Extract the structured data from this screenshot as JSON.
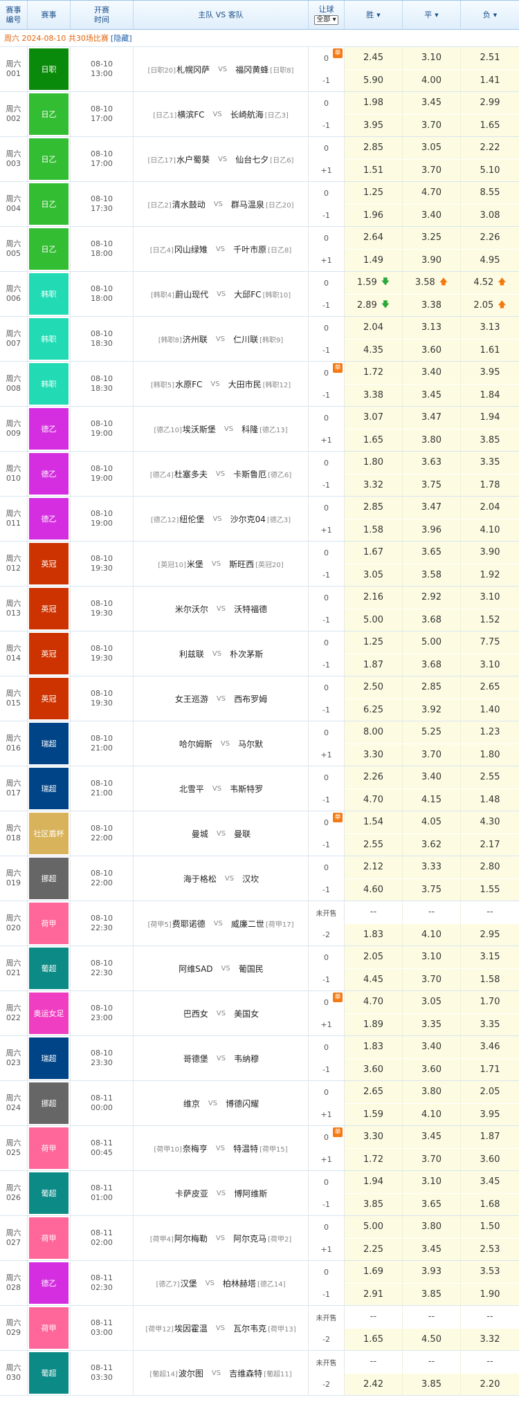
{
  "header": {
    "id_l1": "赛事",
    "id_l2": "编号",
    "league": "赛事",
    "time_l1": "开赛",
    "time_l2": "时间",
    "teams": "主队 VS 客队",
    "handicap": "让球",
    "handicap_select": "全部",
    "win": "胜",
    "draw": "平",
    "lose": "负"
  },
  "day": {
    "text": "周六 2024-08-10 共30场比赛",
    "hide_link": "[隐藏]"
  },
  "colors": {
    "日职": "#0a8a0a",
    "日乙": "#33bd33",
    "韩职": "#22dbb4",
    "德乙": "#d42ee0",
    "英冠": "#cc3300",
    "瑞超": "#004488",
    "社区盾杯": "#d9b35b",
    "挪超": "#666666",
    "荷甲": "#ff6699",
    "葡超": "#0b8a86",
    "奥运女足": "#f03ec2"
  },
  "dan_label": "单",
  "matches": [
    {
      "day": "周六",
      "num": "001",
      "league": "日职",
      "date": "08-10",
      "time": "13:00",
      "home_rank": "[日职20]",
      "home": "札幌冈萨",
      "away": "福冈黄蜂",
      "away_rank": "[日职8]",
      "dan": true,
      "hc": [
        "0",
        "-1"
      ],
      "odds": [
        [
          "2.45",
          "3.10",
          "2.51"
        ],
        [
          "5.90",
          "4.00",
          "1.41"
        ]
      ]
    },
    {
      "day": "周六",
      "num": "002",
      "league": "日乙",
      "date": "08-10",
      "time": "17:00",
      "home_rank": "[日乙1]",
      "home": "横滨FC",
      "away": "长崎航海",
      "away_rank": "[日乙3]",
      "hc": [
        "0",
        "-1"
      ],
      "odds": [
        [
          "1.98",
          "3.45",
          "2.99"
        ],
        [
          "3.95",
          "3.70",
          "1.65"
        ]
      ]
    },
    {
      "day": "周六",
      "num": "003",
      "league": "日乙",
      "date": "08-10",
      "time": "17:00",
      "home_rank": "[日乙17]",
      "home": "水户蜀葵",
      "away": "仙台七夕",
      "away_rank": "[日乙6]",
      "hc": [
        "0",
        "+1"
      ],
      "odds": [
        [
          "2.85",
          "3.05",
          "2.22"
        ],
        [
          "1.51",
          "3.70",
          "5.10"
        ]
      ]
    },
    {
      "day": "周六",
      "num": "004",
      "league": "日乙",
      "date": "08-10",
      "time": "17:30",
      "home_rank": "[日乙2]",
      "home": "清水鼓动",
      "away": "群马温泉",
      "away_rank": "[日乙20]",
      "hc": [
        "0",
        "-1"
      ],
      "odds": [
        [
          "1.25",
          "4.70",
          "8.55"
        ],
        [
          "1.96",
          "3.40",
          "3.08"
        ]
      ]
    },
    {
      "day": "周六",
      "num": "005",
      "league": "日乙",
      "date": "08-10",
      "time": "18:00",
      "home_rank": "[日乙4]",
      "home": "冈山绿雉",
      "away": "千叶市原",
      "away_rank": "[日乙8]",
      "hc": [
        "0",
        "+1"
      ],
      "odds": [
        [
          "2.64",
          "3.25",
          "2.26"
        ],
        [
          "1.49",
          "3.90",
          "4.95"
        ]
      ]
    },
    {
      "day": "周六",
      "num": "006",
      "league": "韩职",
      "date": "08-10",
      "time": "18:00",
      "home_rank": "[韩职4]",
      "home": "蔚山现代",
      "away": "大邱FC",
      "away_rank": "[韩职10]",
      "hc": [
        "0",
        "-1"
      ],
      "odds": [
        [
          "1.59",
          "3.58",
          "4.52"
        ],
        [
          "2.89",
          "3.38",
          "2.05"
        ]
      ],
      "arrows": [
        [
          "down",
          "up",
          "up"
        ],
        [
          "down",
          "",
          "up"
        ]
      ]
    },
    {
      "day": "周六",
      "num": "007",
      "league": "韩职",
      "date": "08-10",
      "time": "18:30",
      "home_rank": "[韩职8]",
      "home": "济州联",
      "away": "仁川联",
      "away_rank": "[韩职9]",
      "hc": [
        "0",
        "-1"
      ],
      "odds": [
        [
          "2.04",
          "3.13",
          "3.13"
        ],
        [
          "4.35",
          "3.60",
          "1.61"
        ]
      ]
    },
    {
      "day": "周六",
      "num": "008",
      "league": "韩职",
      "date": "08-10",
      "time": "18:30",
      "home_rank": "[韩职5]",
      "home": "水原FC",
      "away": "大田市民",
      "away_rank": "[韩职12]",
      "dan": true,
      "hc": [
        "0",
        "-1"
      ],
      "odds": [
        [
          "1.72",
          "3.40",
          "3.95"
        ],
        [
          "3.38",
          "3.45",
          "1.84"
        ]
      ]
    },
    {
      "day": "周六",
      "num": "009",
      "league": "德乙",
      "date": "08-10",
      "time": "19:00",
      "home_rank": "[德乙10]",
      "home": "埃沃斯堡",
      "away": "科隆",
      "away_rank": "[德乙13]",
      "hc": [
        "0",
        "+1"
      ],
      "odds": [
        [
          "3.07",
          "3.47",
          "1.94"
        ],
        [
          "1.65",
          "3.80",
          "3.85"
        ]
      ]
    },
    {
      "day": "周六",
      "num": "010",
      "league": "德乙",
      "date": "08-10",
      "time": "19:00",
      "home_rank": "[德乙4]",
      "home": "杜塞多夫",
      "away": "卡斯鲁厄",
      "away_rank": "[德乙6]",
      "hc": [
        "0",
        "-1"
      ],
      "odds": [
        [
          "1.80",
          "3.63",
          "3.35"
        ],
        [
          "3.32",
          "3.75",
          "1.78"
        ]
      ]
    },
    {
      "day": "周六",
      "num": "011",
      "league": "德乙",
      "date": "08-10",
      "time": "19:00",
      "home_rank": "[德乙12]",
      "home": "纽伦堡",
      "away": "沙尔克04",
      "away_rank": "[德乙3]",
      "hc": [
        "0",
        "+1"
      ],
      "odds": [
        [
          "2.85",
          "3.47",
          "2.04"
        ],
        [
          "1.58",
          "3.96",
          "4.10"
        ]
      ]
    },
    {
      "day": "周六",
      "num": "012",
      "league": "英冠",
      "date": "08-10",
      "time": "19:30",
      "home_rank": "[英冠10]",
      "home": "米堡",
      "away": "斯旺西",
      "away_rank": "[英冠20]",
      "hc": [
        "0",
        "-1"
      ],
      "odds": [
        [
          "1.67",
          "3.65",
          "3.90"
        ],
        [
          "3.05",
          "3.58",
          "1.92"
        ]
      ]
    },
    {
      "day": "周六",
      "num": "013",
      "league": "英冠",
      "date": "08-10",
      "time": "19:30",
      "home_rank": "",
      "home": "米尔沃尔",
      "away": "沃特福德",
      "away_rank": "",
      "hc": [
        "0",
        "-1"
      ],
      "odds": [
        [
          "2.16",
          "2.92",
          "3.10"
        ],
        [
          "5.00",
          "3.68",
          "1.52"
        ]
      ]
    },
    {
      "day": "周六",
      "num": "014",
      "league": "英冠",
      "date": "08-10",
      "time": "19:30",
      "home_rank": "",
      "home": "利兹联",
      "away": "朴次茅斯",
      "away_rank": "",
      "hc": [
        "0",
        "-1"
      ],
      "odds": [
        [
          "1.25",
          "5.00",
          "7.75"
        ],
        [
          "1.87",
          "3.68",
          "3.10"
        ]
      ]
    },
    {
      "day": "周六",
      "num": "015",
      "league": "英冠",
      "date": "08-10",
      "time": "19:30",
      "home_rank": "",
      "home": "女王巡游",
      "away": "西布罗姆",
      "away_rank": "",
      "hc": [
        "0",
        "-1"
      ],
      "odds": [
        [
          "2.50",
          "2.85",
          "2.65"
        ],
        [
          "6.25",
          "3.92",
          "1.40"
        ]
      ]
    },
    {
      "day": "周六",
      "num": "016",
      "league": "瑞超",
      "date": "08-10",
      "time": "21:00",
      "home_rank": "",
      "home": "哈尔姆斯",
      "away": "马尔默",
      "away_rank": "",
      "hc": [
        "0",
        "+1"
      ],
      "odds": [
        [
          "8.00",
          "5.25",
          "1.23"
        ],
        [
          "3.30",
          "3.70",
          "1.80"
        ]
      ]
    },
    {
      "day": "周六",
      "num": "017",
      "league": "瑞超",
      "date": "08-10",
      "time": "21:00",
      "home_rank": "",
      "home": "北雪平",
      "away": "韦斯特罗",
      "away_rank": "",
      "hc": [
        "0",
        "-1"
      ],
      "odds": [
        [
          "2.26",
          "3.40",
          "2.55"
        ],
        [
          "4.70",
          "4.15",
          "1.48"
        ]
      ]
    },
    {
      "day": "周六",
      "num": "018",
      "league": "社区盾杯",
      "date": "08-10",
      "time": "22:00",
      "home_rank": "",
      "home": "曼城",
      "away": "曼联",
      "away_rank": "",
      "dan": true,
      "hc": [
        "0",
        "-1"
      ],
      "odds": [
        [
          "1.54",
          "4.05",
          "4.30"
        ],
        [
          "2.55",
          "3.62",
          "2.17"
        ]
      ]
    },
    {
      "day": "周六",
      "num": "019",
      "league": "挪超",
      "date": "08-10",
      "time": "22:00",
      "home_rank": "",
      "home": "海于格松",
      "away": "汉坎",
      "away_rank": "",
      "hc": [
        "0",
        "-1"
      ],
      "odds": [
        [
          "2.12",
          "3.33",
          "2.80"
        ],
        [
          "4.60",
          "3.75",
          "1.55"
        ]
      ]
    },
    {
      "day": "周六",
      "num": "020",
      "league": "荷甲",
      "date": "08-10",
      "time": "22:30",
      "home_rank": "[荷甲5]",
      "home": "费耶诺德",
      "away": "威廉二世",
      "away_rank": "[荷甲17]",
      "hc": [
        "未开售",
        "-2"
      ],
      "odds": [
        [
          "--",
          "--",
          "--"
        ],
        [
          "1.83",
          "4.10",
          "2.95"
        ]
      ]
    },
    {
      "day": "周六",
      "num": "021",
      "league": "葡超",
      "date": "08-10",
      "time": "22:30",
      "home_rank": "",
      "home": "阿维SAD",
      "away": "葡国民",
      "away_rank": "",
      "hc": [
        "0",
        "-1"
      ],
      "odds": [
        [
          "2.05",
          "3.10",
          "3.15"
        ],
        [
          "4.45",
          "3.70",
          "1.58"
        ]
      ]
    },
    {
      "day": "周六",
      "num": "022",
      "league": "奥运女足",
      "date": "08-10",
      "time": "23:00",
      "home_rank": "",
      "home": "巴西女",
      "away": "美国女",
      "away_rank": "",
      "dan": true,
      "hc": [
        "0",
        "+1"
      ],
      "odds": [
        [
          "4.70",
          "3.05",
          "1.70"
        ],
        [
          "1.89",
          "3.35",
          "3.35"
        ]
      ]
    },
    {
      "day": "周六",
      "num": "023",
      "league": "瑞超",
      "date": "08-10",
      "time": "23:30",
      "home_rank": "",
      "home": "哥德堡",
      "away": "韦纳穆",
      "away_rank": "",
      "hc": [
        "0",
        "-1"
      ],
      "odds": [
        [
          "1.83",
          "3.40",
          "3.46"
        ],
        [
          "3.60",
          "3.60",
          "1.71"
        ]
      ]
    },
    {
      "day": "周六",
      "num": "024",
      "league": "挪超",
      "date": "08-11",
      "time": "00:00",
      "home_rank": "",
      "home": "维京",
      "away": "博德闪耀",
      "away_rank": "",
      "hc": [
        "0",
        "+1"
      ],
      "odds": [
        [
          "2.65",
          "3.80",
          "2.05"
        ],
        [
          "1.59",
          "4.10",
          "3.95"
        ]
      ]
    },
    {
      "day": "周六",
      "num": "025",
      "league": "荷甲",
      "date": "08-11",
      "time": "00:45",
      "home_rank": "[荷甲10]",
      "home": "奈梅亨",
      "away": "特温特",
      "away_rank": "[荷甲15]",
      "dan": true,
      "hc": [
        "0",
        "+1"
      ],
      "odds": [
        [
          "3.30",
          "3.45",
          "1.87"
        ],
        [
          "1.72",
          "3.70",
          "3.60"
        ]
      ]
    },
    {
      "day": "周六",
      "num": "026",
      "league": "葡超",
      "date": "08-11",
      "time": "01:00",
      "home_rank": "",
      "home": "卡萨皮亚",
      "away": "博阿维斯",
      "away_rank": "",
      "hc": [
        "0",
        "-1"
      ],
      "odds": [
        [
          "1.94",
          "3.10",
          "3.45"
        ],
        [
          "3.85",
          "3.65",
          "1.68"
        ]
      ]
    },
    {
      "day": "周六",
      "num": "027",
      "league": "荷甲",
      "date": "08-11",
      "time": "02:00",
      "home_rank": "[荷甲4]",
      "home": "阿尔梅勒",
      "away": "阿尔克马",
      "away_rank": "[荷甲2]",
      "hc": [
        "0",
        "+1"
      ],
      "odds": [
        [
          "5.00",
          "3.80",
          "1.50"
        ],
        [
          "2.25",
          "3.45",
          "2.53"
        ]
      ]
    },
    {
      "day": "周六",
      "num": "028",
      "league": "德乙",
      "date": "08-11",
      "time": "02:30",
      "home_rank": "[德乙7]",
      "home": "汉堡",
      "away": "柏林赫塔",
      "away_rank": "[德乙14]",
      "hc": [
        "0",
        "-1"
      ],
      "odds": [
        [
          "1.69",
          "3.93",
          "3.53"
        ],
        [
          "2.91",
          "3.85",
          "1.90"
        ]
      ]
    },
    {
      "day": "周六",
      "num": "029",
      "league": "荷甲",
      "date": "08-11",
      "time": "03:00",
      "home_rank": "[荷甲12]",
      "home": "埃因霍温",
      "away": "瓦尔韦克",
      "away_rank": "[荷甲13]",
      "hc": [
        "未开售",
        "-2"
      ],
      "odds": [
        [
          "--",
          "--",
          "--"
        ],
        [
          "1.65",
          "4.50",
          "3.32"
        ]
      ]
    },
    {
      "day": "周六",
      "num": "030",
      "league": "葡超",
      "date": "08-11",
      "time": "03:30",
      "home_rank": "[葡超14]",
      "home": "波尔图",
      "away": "吉维森特",
      "away_rank": "[葡超11]",
      "hc": [
        "未开售",
        "-2"
      ],
      "odds": [
        [
          "--",
          "--",
          "--"
        ],
        [
          "2.42",
          "3.85",
          "2.20"
        ]
      ]
    }
  ]
}
